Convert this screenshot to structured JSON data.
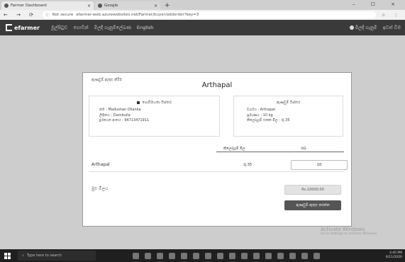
{
  "browser": {
    "tabs": [
      {
        "label": "Farmer Dashboard",
        "active": true
      },
      {
        "label": "Google",
        "active": false
      }
    ],
    "url_prefix": "Not secure",
    "url": "efarmer-web.azurewebsites.net/Farmer/buyer/addorder?key=3"
  },
  "navbar": {
    "logo": "efarmer",
    "links": [
      "මුල්පිටුව",
      "ගොවීන්",
      "මිලදී ගැනුම්ලේඛණ",
      "English"
    ],
    "right": [
      "මිලදී ගැනුම්",
      "ඉවත් වීම"
    ]
  },
  "card": {
    "label": "ඇණවුම් ඇතුළු කිරීම",
    "title": "Arthapal",
    "seller_box": {
      "header": "ගොවිමහතා විස්තර",
      "lines": [
        "නම : Madushan Dilanka",
        "ලිපිනය : Dambulla",
        "දුරකථන අංකය : 94713471911"
      ]
    },
    "product_box": {
      "header": "ඇණවුම් විස්තර",
      "lines": [
        "වර්ගය : Arthapal",
        "ප්‍රමාණය : 10 kg",
        "කිලෝග්‍රෑම් එකක මිල : රු.35"
      ]
    },
    "qty_header": [
      "කිලෝග්‍රෑම් මිල",
      "kG"
    ],
    "product_name": "Arthapal",
    "unit": "රු.35",
    "qty_value": "10",
    "total_label": "මුළු මිලය",
    "total_value": "Rs.10000.00",
    "order_button": "ඇණවුම් ඇතුළු කරන්න"
  },
  "watermark": {
    "title": "Activate Windows",
    "sub": "Go to Settings to activate Windows."
  },
  "taskbar": {
    "search_placeholder": "Type here to search",
    "time": "3:45 PM",
    "date": "6/11/2020"
  }
}
